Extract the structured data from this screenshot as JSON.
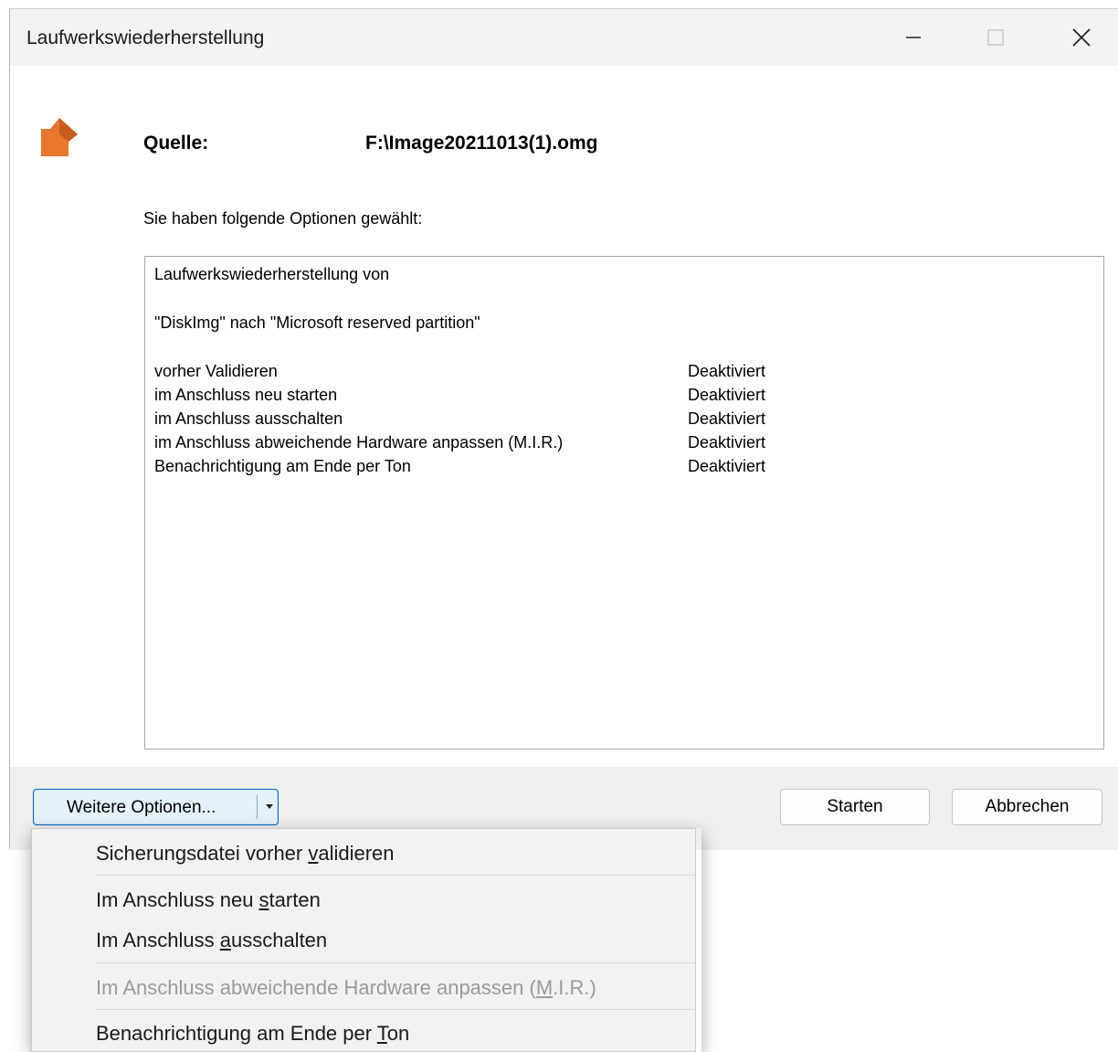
{
  "window": {
    "title": "Laufwerkswiederherstellung",
    "controls": [
      "minimize-icon",
      "maximize-icon",
      "close-icon"
    ]
  },
  "source": {
    "label": "Quelle:",
    "value": "F:\\Image20211013(1).omg"
  },
  "intro": "Sie haben folgende Optionen gewählt:",
  "summary": {
    "line1": "Laufwerkswiederherstellung von",
    "line2": "\"DiskImg\" nach \"Microsoft reserved partition\"",
    "options": [
      {
        "name": "vorher Validieren",
        "status": "Deaktiviert"
      },
      {
        "name": "im Anschluss neu starten",
        "status": "Deaktiviert"
      },
      {
        "name": "im Anschluss ausschalten",
        "status": "Deaktiviert"
      },
      {
        "name": "im Anschluss abweichende Hardware anpassen (M.I.R.)",
        "status": "Deaktiviert"
      },
      {
        "name": "Benachrichtigung am Ende per Ton",
        "status": "Deaktiviert"
      }
    ]
  },
  "footer": {
    "more_options_label": "Weitere Optionen...",
    "start_label": "Starten",
    "cancel_label": "Abbrechen"
  },
  "menu": {
    "items": [
      {
        "pre": "Sicherungsdatei vorher ",
        "mnemonic": "v",
        "post": "alidieren",
        "enabled": true
      },
      {
        "pre": "Im Anschluss neu ",
        "mnemonic": "s",
        "post": "tarten",
        "enabled": true
      },
      {
        "pre": "Im Anschluss ",
        "mnemonic": "a",
        "post": "usschalten",
        "enabled": true
      },
      {
        "pre": "Im Anschluss abweichende Hardware anpassen (",
        "mnemonic": "M",
        "post": ".I.R.)",
        "enabled": false
      },
      {
        "pre": "Benachrichtigung am Ende per ",
        "mnemonic": "T",
        "post": "on",
        "enabled": true
      }
    ]
  },
  "colors": {
    "accent": "#0067c0",
    "icon_orange": "#e8772e",
    "disabled_text": "#9a9a9a"
  }
}
